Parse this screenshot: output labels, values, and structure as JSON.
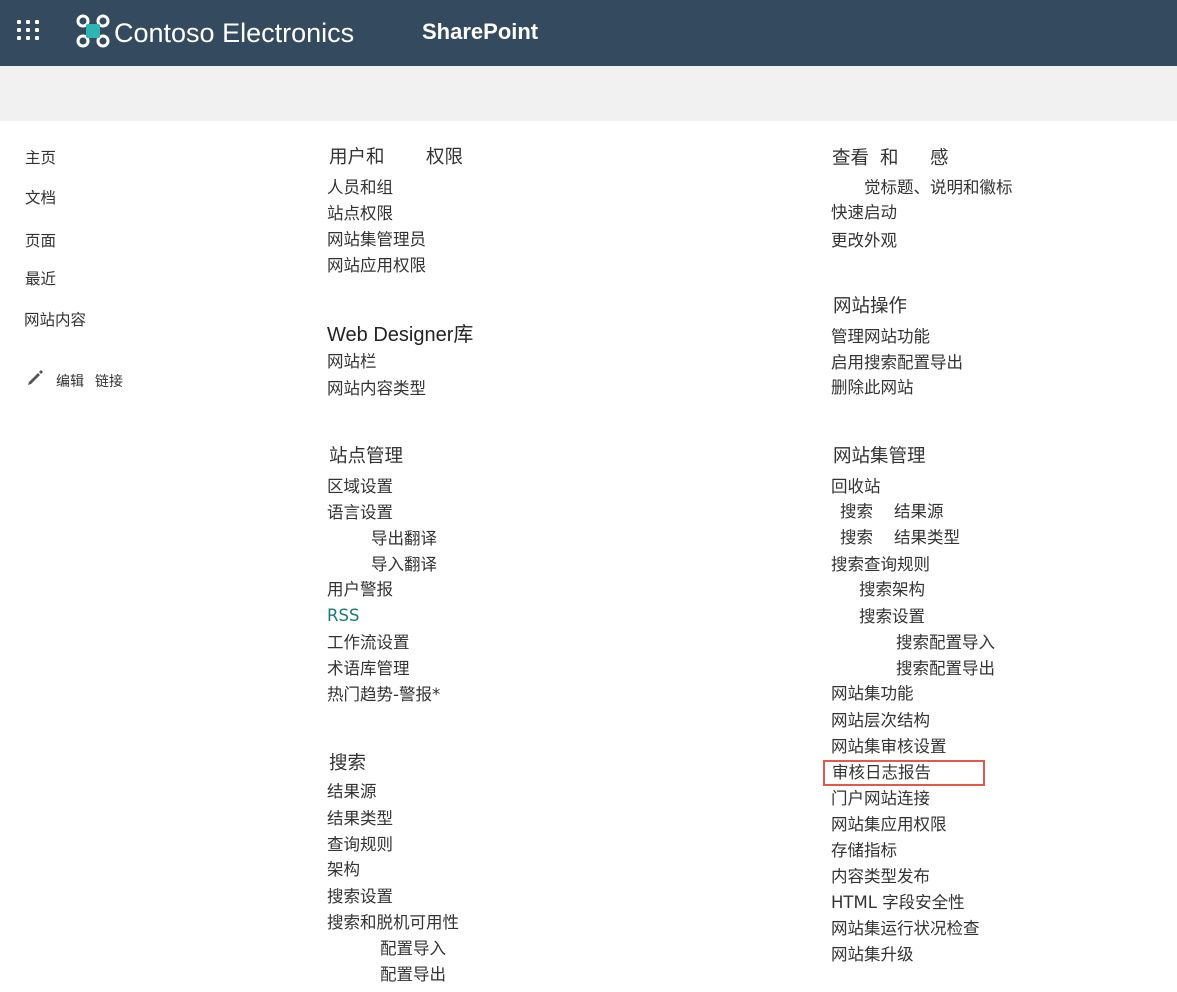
{
  "header": {
    "brand": "Contoso Electronics",
    "suite": "SharePoint",
    "waffle_icon": "app-launcher-icon",
    "logo_icon": "contoso-logo-icon",
    "bar_color": "#344a5f"
  },
  "left_nav": {
    "items": [
      "主页",
      "文档",
      "页面",
      "最近",
      "网站内容"
    ],
    "edit_icon": "pencil-icon",
    "edit_label": "编辑",
    "links_label": "链接"
  },
  "columns": {
    "users": {
      "heading_a": "用户和",
      "heading_b": "权限",
      "items": [
        "人员和组",
        "站点权限",
        "网站集管理员",
        "网站应用权限"
      ]
    },
    "web_designer": {
      "heading": "Web Designer库",
      "items": [
        "网站栏",
        "网站内容类型"
      ]
    },
    "site_admin": {
      "heading": "站点管理",
      "items": [
        "区域设置",
        "语言设置",
        "导出翻译",
        "导入翻译",
        "用户警报",
        "RSS",
        "工作流设置",
        "术语库管理",
        "热门趋势-警报*"
      ]
    },
    "search": {
      "heading": "搜索",
      "items": [
        "结果源",
        "结果类型",
        "查询规则",
        "架构",
        "搜索设置",
        "搜索和脱机可用性",
        "配置导入",
        "配置导出"
      ]
    },
    "look": {
      "heading_a": "查看",
      "heading_b": "和",
      "heading_c": "感",
      "items": [
        "觉标题、说明和徽标",
        "快速启动",
        "更改外观"
      ]
    },
    "site_actions": {
      "heading": "网站操作",
      "items": [
        "管理网站功能",
        "启用搜索配置导出",
        "删除此网站"
      ]
    },
    "site_collection": {
      "heading": "网站集管理",
      "items": [
        "回收站",
        "搜索",
        "结果源",
        "搜索",
        "结果类型",
        "搜索查询规则",
        "搜索架构",
        "搜索设置",
        "搜索配置导入",
        "搜索配置导出",
        "网站集功能",
        "网站层次结构",
        "网站集审核设置",
        "审核日志报告",
        "门户网站连接",
        "网站集应用权限",
        "存储指标",
        "内容类型发布",
        "HTML 字段安全性",
        "网站集运行状况检查",
        "网站集升级"
      ],
      "highlighted": "审核日志报告",
      "highlight_color": "#e2584f"
    }
  },
  "colors": {
    "link": "#1c7a7a",
    "subbar": "#f1f1f1"
  }
}
